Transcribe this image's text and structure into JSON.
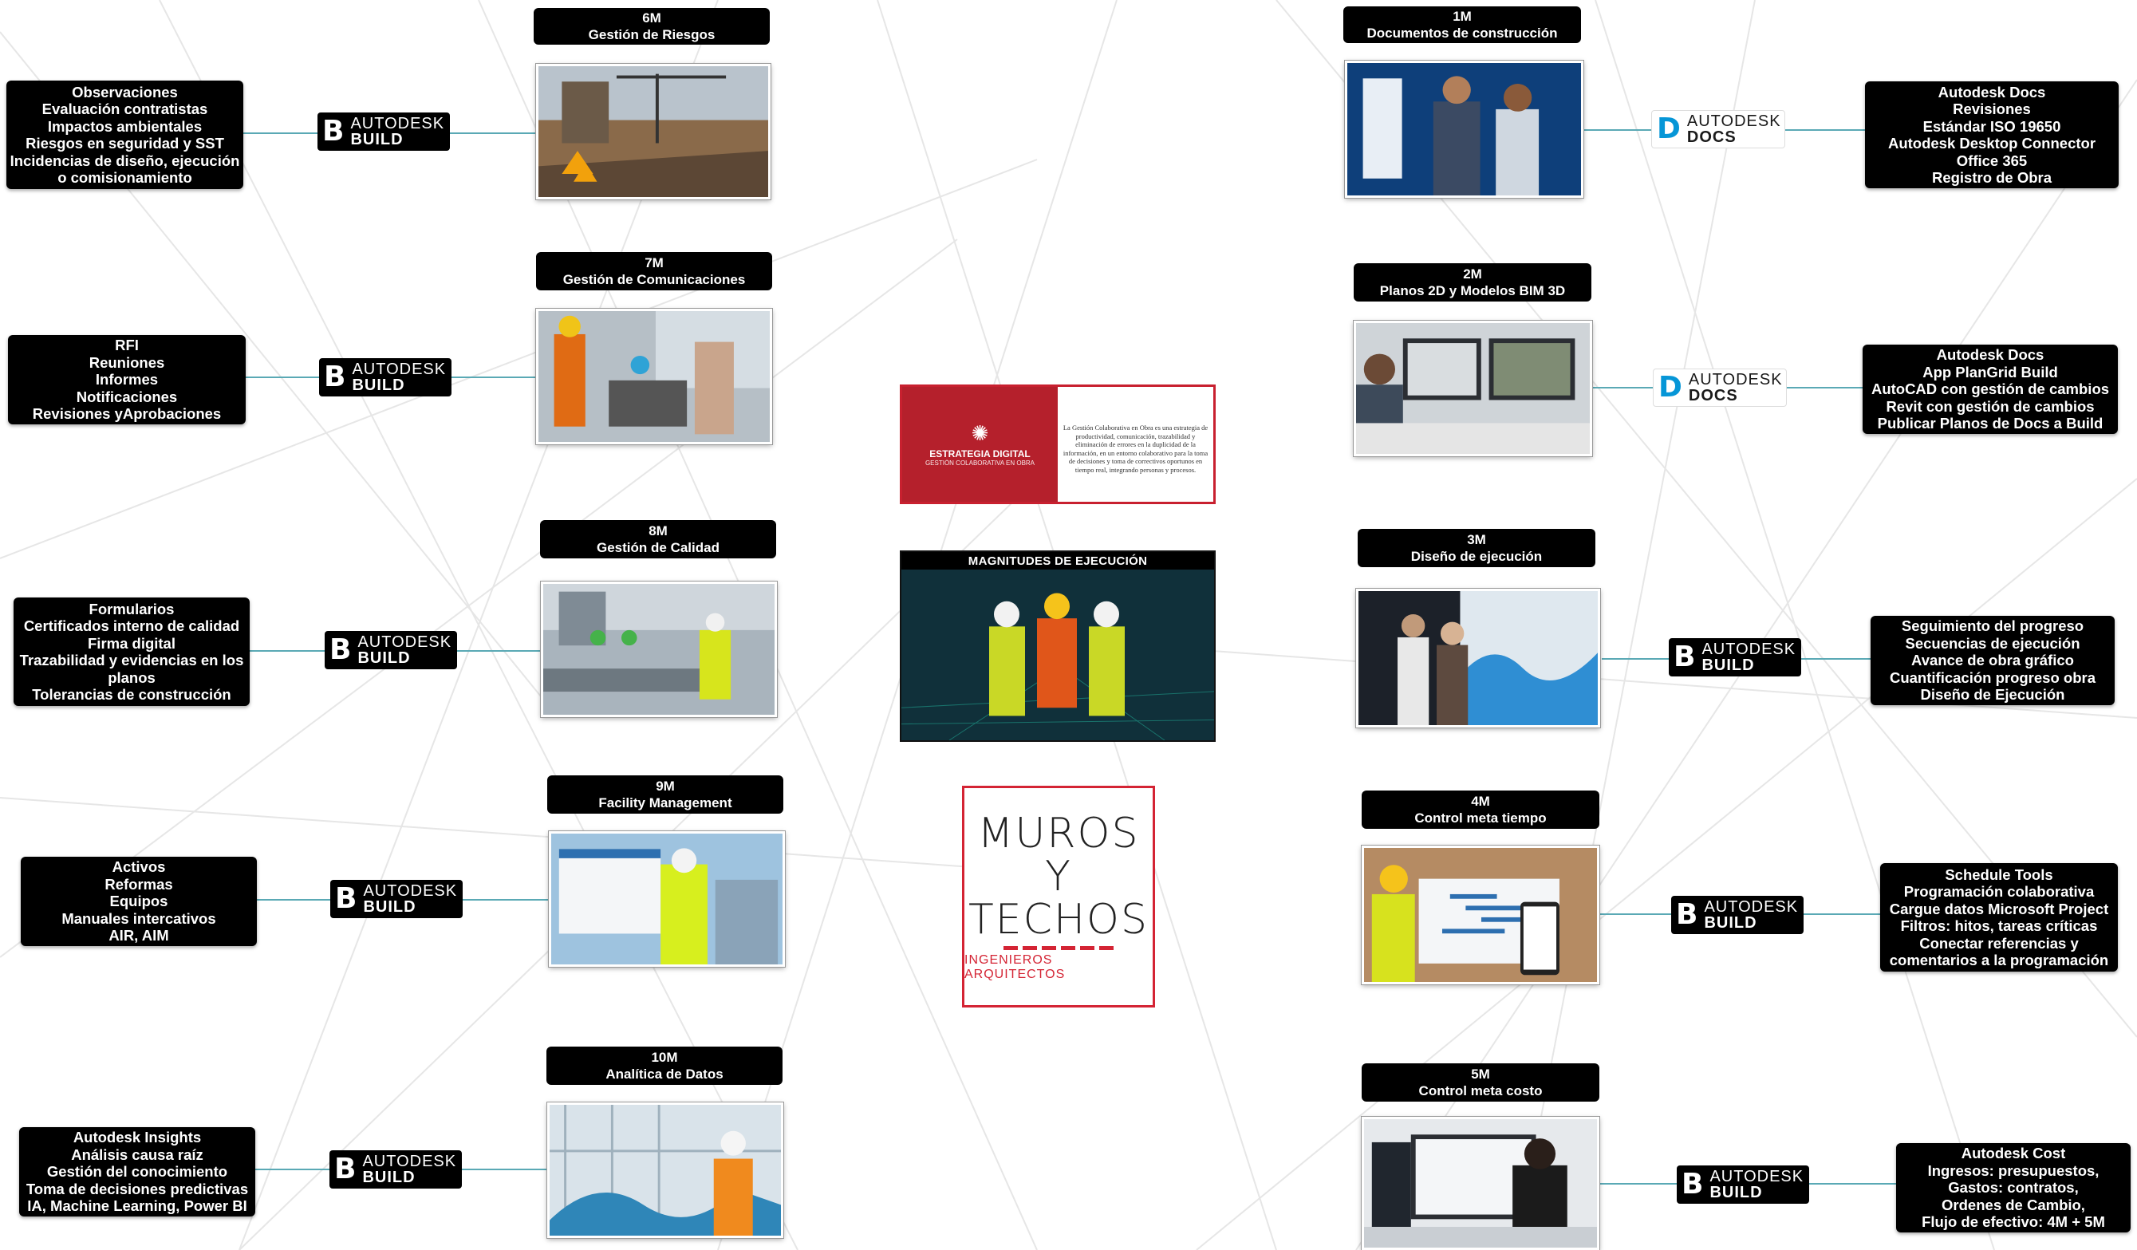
{
  "center": {
    "strategy_title": "ESTRATEGIA DIGITAL",
    "strategy_subtitle": "GESTIÓN COLABORATIVA EN OBRA",
    "strategy_text": "La Gestión Colaborativa en Obra es una estrategia de productividad, comunicación, trazabilidad y eliminación de errores en la duplicidad de la información, en un entorno colaborativo para la toma de decisiones y toma de correctivos oportunos en tiempo real, integrando personas y procesos.",
    "magnitudes_title": "MAGNITUDES DE EJECUCIÓN",
    "logo_line1": "MUROS Y",
    "logo_line2": "TECHOS",
    "logo_line3": "INGENIEROS ARQUITECTOS"
  },
  "left": [
    {
      "code": "6M",
      "title": "Gestión de Riesgos",
      "badge": {
        "brand": "AUTODESK",
        "product": "BUILD",
        "logo": "B"
      },
      "items": [
        "Observaciones",
        "Evaluación contratistas",
        "Impactos ambientales",
        "Riesgos en seguridad y SST",
        "Incidencias de diseño, ejecución",
        "o comisionamiento"
      ]
    },
    {
      "code": "7M",
      "title": "Gestión de Comunicaciones",
      "badge": {
        "brand": "AUTODESK",
        "product": "BUILD",
        "logo": "B"
      },
      "items": [
        "RFI",
        "Reuniones",
        "Informes",
        "Notificaciones",
        "Revisiones yAprobaciones"
      ]
    },
    {
      "code": "8M",
      "title": "Gestión de Calidad",
      "badge": {
        "brand": "AUTODESK",
        "product": "BUILD",
        "logo": "B"
      },
      "items": [
        "Formularios",
        "Certificados interno de calidad",
        "Firma digital",
        "Trazabilidad y evidencias en los",
        "planos",
        "Tolerancias de construcción"
      ]
    },
    {
      "code": "9M",
      "title": "Facility Management",
      "badge": {
        "brand": "AUTODESK",
        "product": "BUILD",
        "logo": "B"
      },
      "items": [
        "Activos",
        "Reformas",
        "Equipos",
        "Manuales intercativos",
        "AIR, AIM"
      ]
    },
    {
      "code": "10M",
      "title": "Analítica de Datos",
      "badge": {
        "brand": "AUTODESK",
        "product": "BUILD",
        "logo": "B"
      },
      "items": [
        "Autodesk Insights",
        "Análisis causa raíz",
        "Gestión del conocimiento",
        "Toma de decisiones predictivas",
        "IA, Machine Learning, Power BI"
      ]
    }
  ],
  "right": [
    {
      "code": "1M",
      "title": "Documentos de construcción",
      "badge": {
        "brand": "AUTODESK",
        "product": "DOCS",
        "logo": "D"
      },
      "items": [
        "Autodesk Docs",
        "Revisiones",
        "Estándar ISO 19650",
        "Autodesk Desktop Connector",
        "Office 365",
        "Registro de Obra"
      ]
    },
    {
      "code": "2M",
      "title": "Planos 2D y Modelos BIM 3D",
      "badge": {
        "brand": "AUTODESK",
        "product": "DOCS",
        "logo": "D"
      },
      "items": [
        "Autodesk Docs",
        "App PlanGrid Build",
        "AutoCAD con gestión de cambios",
        "Revit con gestión de cambios",
        "Publicar Planos de Docs a Build"
      ]
    },
    {
      "code": "3M",
      "title": "Diseño de ejecución",
      "badge": {
        "brand": "AUTODESK",
        "product": "BUILD",
        "logo": "B"
      },
      "items": [
        "Seguimiento del progreso",
        "Secuencias de ejecución",
        "Avance de obra gráfico",
        "Cuantificación progreso obra",
        "Diseño de Ejecución"
      ]
    },
    {
      "code": "4M",
      "title": "Control meta tiempo",
      "badge": {
        "brand": "AUTODESK",
        "product": "BUILD",
        "logo": "B"
      },
      "items": [
        "Schedule Tools",
        "Programación colaborativa",
        "Cargue datos Microsoft Project",
        "Filtros: hitos, tareas críticas",
        "Conectar referencias y",
        "comentarios a la programación"
      ]
    },
    {
      "code": "5M",
      "title": "Control meta costo",
      "badge": {
        "brand": "AUTODESK",
        "product": "BUILD",
        "logo": "B"
      },
      "items": [
        "Autodesk Cost",
        "Ingresos: presupuestos,",
        "Gastos: contratos,",
        "Ordenes de Cambio,",
        "Flujo de efectivo: 4M + 5M"
      ]
    }
  ]
}
